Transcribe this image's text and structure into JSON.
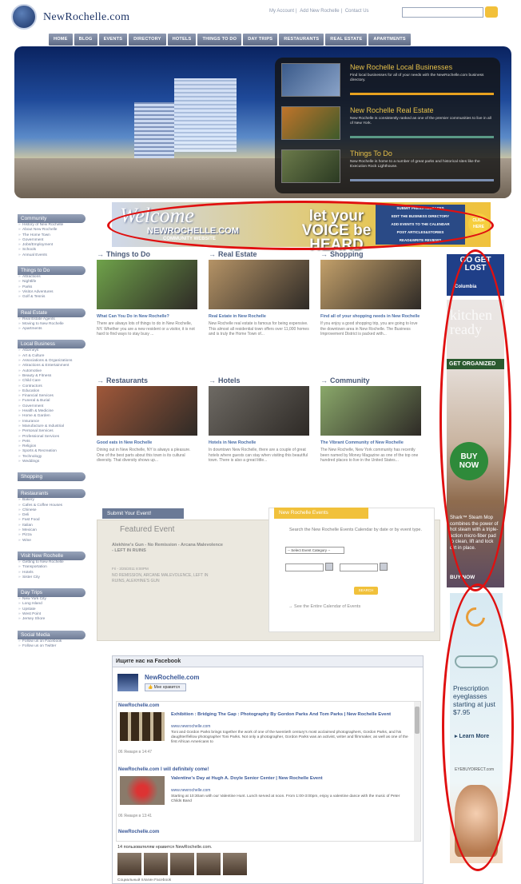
{
  "site": {
    "name": "NewRochelle.com",
    "toplinks": [
      "My Account",
      "Add New Rochelle",
      "Contact Us"
    ],
    "search_placeholder": ""
  },
  "nav": [
    "HOME",
    "BLOG",
    "EVENTS",
    "DIRECTORY",
    "HOTELS",
    "THINGS TO DO",
    "DAY TRIPS",
    "RESTAURANTS",
    "REAL ESTATE",
    "APARTMENTS"
  ],
  "hero": {
    "features": [
      {
        "title": "New Rochelle Local Businesses",
        "desc": "Find local businesses for all of your needs with the NewRochelle.com business directory.",
        "bar": "#e8a21f"
      },
      {
        "title": "New Rochelle Real Estate",
        "desc": "New Rochelle is consistently ranked as one of the premier communities to live in all of New York.",
        "bar": "#5a9a86"
      },
      {
        "title": "Things To Do",
        "desc": "New Rochelle is home to a number of great parks and historical sites like the Execution Rock Lighthouse.",
        "bar": "#7c8fb1"
      }
    ]
  },
  "sidebar": [
    {
      "head": "Community",
      "items": [
        "History of New Rochelle",
        "About New Rochelle",
        "The Home Town",
        "Government",
        "Jobs/Employment",
        "Schools",
        "Annual Events"
      ]
    },
    {
      "head": "Things to Do",
      "items": [
        "Attractions",
        "Nightlife",
        "Parks",
        "Visitor Adventures",
        "Golf & Tennis"
      ]
    },
    {
      "head": "Real Estate",
      "items": [
        "Real Estate Agents",
        "Moving to New Rochelle",
        "Apartments"
      ]
    },
    {
      "head": "Local Business",
      "items": [
        "Attorneys",
        "Art & Culture",
        "Associations & Organizations",
        "Attractions & Entertainment",
        "Automotive",
        "Beauty & Fitness",
        "Child Care",
        "Contractors",
        "Education",
        "Financial Services",
        "Funeral & Burial",
        "Government",
        "Health & Medicine",
        "Home & Garden",
        "Insurance",
        "Manufacture & Industrial",
        "Personal Services",
        "Professional Services",
        "Pets",
        "Religion",
        "Sports & Recreation",
        "Technology",
        "Weddings"
      ]
    },
    {
      "head": "Shopping",
      "items": []
    },
    {
      "head": "Restaurants",
      "items": [
        "Bakery",
        "Cafes & Coffee Houses",
        "Chinese",
        "Deli",
        "Fast Food",
        "Italian",
        "Mexican",
        "Pizza",
        "Wine"
      ]
    },
    {
      "head": "Visit New Rochelle",
      "items": [
        "Getting to New Rochelle",
        "Transportation",
        "Hotels",
        "Sister City"
      ]
    },
    {
      "head": "Day Trips",
      "items": [
        "New York City",
        "Long Island",
        "Upstate",
        "West Point",
        "Jersey Shore"
      ]
    },
    {
      "head": "Social Media",
      "items": [
        "Follow us on Facebook",
        "Follow us on Twitter"
      ]
    }
  ],
  "welcome": {
    "w1": "Welcome",
    "w2": "NEWROCHELLE.COM",
    "w3": "COMMUNITY WEBSITE",
    "voice": "let your VOICE be HEARD",
    "links": [
      "SUBMIT PRESS RELEASES",
      "EDIT THE BUSINESS DIRECTORY",
      "ADD EVENTS TO THE CALENDAR",
      "POST ARTICLES&STORIES",
      "READ&WRITE REVIEWS"
    ],
    "click": "CLICK HERE"
  },
  "categories": [
    {
      "head": "Things to Do",
      "title": "What Can You Do in New Rochelle?",
      "desc": "There are always lots of things to do in New Rochelle, NY. Whether you are a new resident or a visitor, it is not hard to find ways to stay busy ...",
      "color": "#6fa24a"
    },
    {
      "head": "Real Estate",
      "title": "Real Estate in New Rochelle",
      "desc": "New Rochelle real estate is famous for being expensive. This almost all residential town offers over 11,000 homes and is truly the Home Town of...",
      "color": "#b59366"
    },
    {
      "head": "Shopping",
      "title": "Find all of your shopping needs in New Rochelle",
      "desc": "If you enjoy a good shopping trip, you are going to love the downtown area in New Rochelle. The Business Improvement District is packed with...",
      "color": "#c3a06a"
    },
    {
      "head": "Restaurants",
      "title": "Good eats in New Rochelle",
      "desc": "Dining out in New Rochelle, NY is always a pleasure. One of the best parts about this town is its cultural diversity. That diversity shows up...",
      "color": "#a0583a"
    },
    {
      "head": "Hotels",
      "title": "Hotels in New Rochelle",
      "desc": "In downtown New Rochelle, there are a couple of great hotels where guests can stay when visiting this beautiful town. There is also a great little...",
      "color": "#6e6a64"
    },
    {
      "head": "Community",
      "title": "The Vibrant Community of New Rochelle",
      "desc": "The New Rochelle, New York community has recently been named by Money Magazine as one of the top one hundred places to live in the United States...",
      "color": "#8aa86a"
    }
  ],
  "event": {
    "submit": "Submit Your Event!",
    "featured": "Featured Event",
    "name": "Alekhine's Gun - No Remission - Arcana Malevolence - LEFT IN RUINS",
    "date": "Fri - 3/25/2011 8:00PM",
    "desc": "NO REMISSION, ARCANE MALEVOLENCE, LEFT IN RUINS, ALEKHINE'S GUN",
    "cal_tab": "New Rochelle Events",
    "cal_text": "Search the New Rochelle Events Calendar by date or by event type.",
    "select": "-- Select Event Category --",
    "search": "SEARCH",
    "cal_link": "See the Entire Calendar of Events"
  },
  "facebook": {
    "head": "Ищите нас на Facebook",
    "page": "NewRochelle.com",
    "like": "Мне нравится",
    "posts": [
      {
        "src": "NewRochelle.com",
        "title": "Exhibition : Bridging The Gap : Photography By Gordon Parks And Tom Parks | New Rochelle Event",
        "url": "www.newrochelle.com",
        "desc": "Toni and Gordon Parks brings together the work of one of the twentieth century's most acclaimed photographers, Gordon Parks, and his daughter/fellow photographer Toni Parks. Not only a photographer, Gordon Parks was an activist, writer and filmmaker, as well as one of the first African Americans to",
        "ts": "06 Января в 14:47"
      },
      {
        "src": "NewRochelle.com I will definitely come!",
        "title": "Valentine's Day at Hugh A. Doyle Senior Center | New Rochelle Event",
        "url": "www.newrochelle.com",
        "desc": "Starting at 10:30am with our Valentine Hunt. Lunch served at noon. From 1:00-3:00pm, enjoy a valentine dance with the music of Peter Childs Band",
        "ts": "06 Января в 13:41"
      },
      {
        "src": "NewRochelle.com",
        "title": "",
        "url": "",
        "desc": "",
        "ts": ""
      }
    ],
    "count": "14 пользователям нравится NewRochelle.com.",
    "plugin": "Социальный плагин Facebook"
  },
  "ads": {
    "ad1a": "GO GET LOST",
    "ad1b": "Columbia",
    "ad2top": "kitchen ready",
    "ad2get": "GET ORGANIZED",
    "ad2buy": "BUY NOW",
    "ad2sh": "Shark™ Steam Mop combines the power of hot steam with a triple-action micro-fiber pad to clean, lift and lock dirt in place.",
    "ad2bn": "BUY NOW",
    "ad3t1": "Prescription eyeglasses starting at just $7.95",
    "ad3t2": "▸ Learn More",
    "ad3t3": "EYEBUYDIRECT.com"
  }
}
